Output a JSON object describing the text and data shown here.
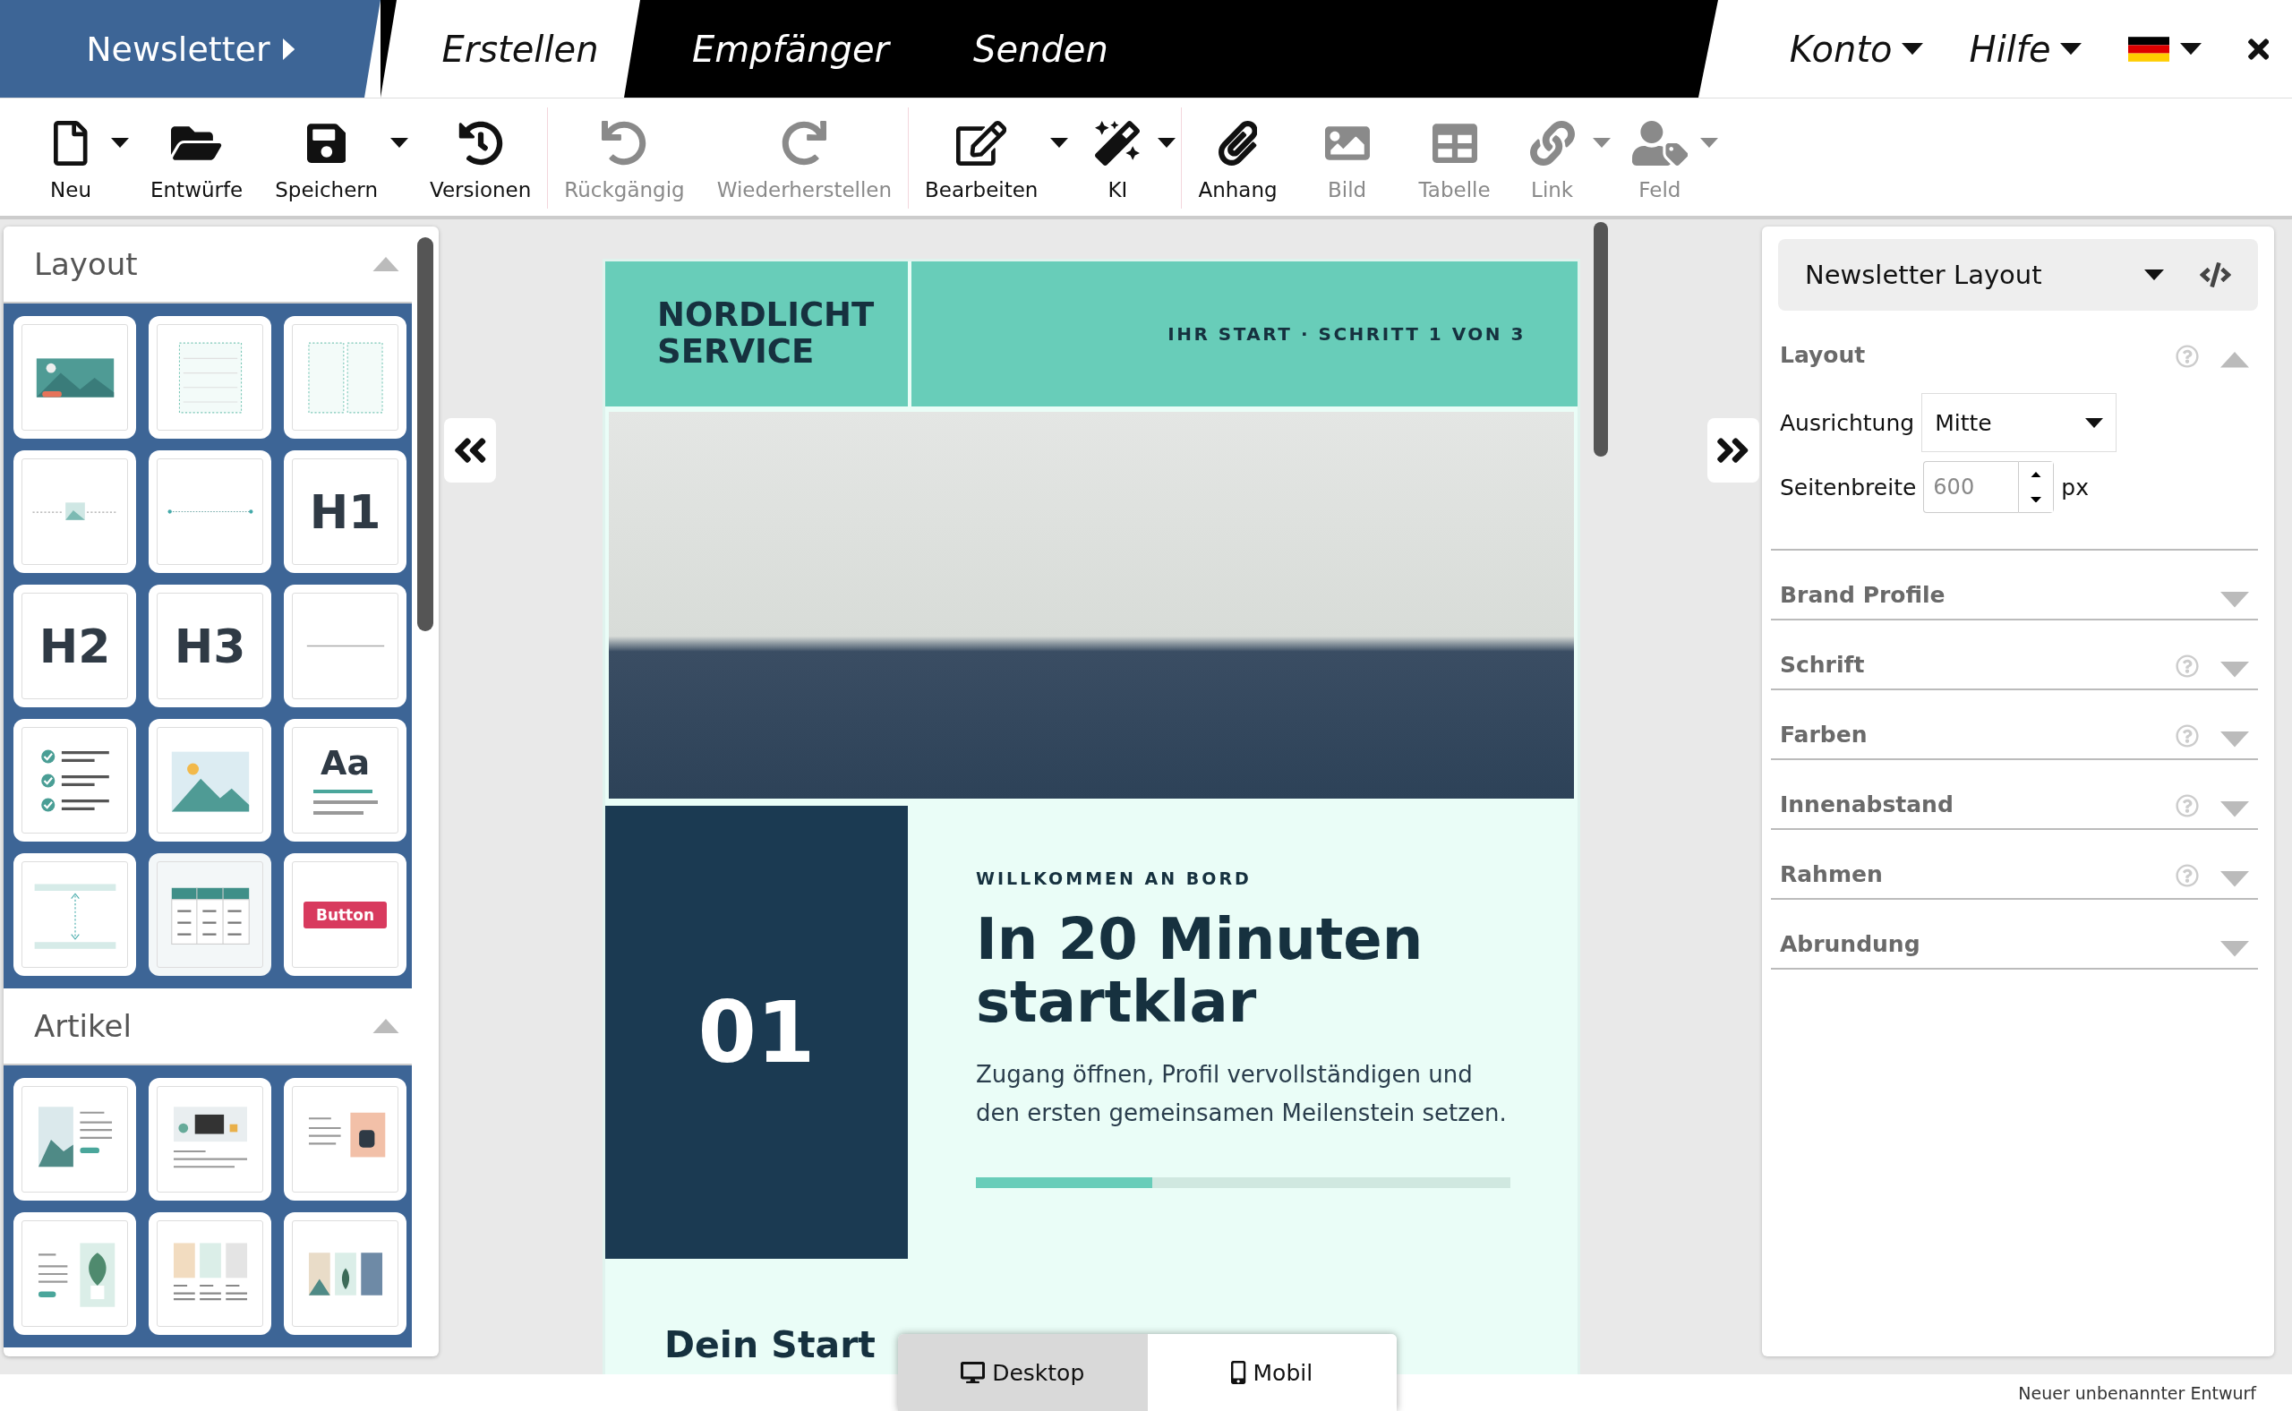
{
  "app_menu": {
    "label": "Newsletter"
  },
  "tabs": [
    {
      "label": "Erstellen",
      "selected": true
    },
    {
      "label": "Empfänger",
      "selected": false
    },
    {
      "label": "Senden",
      "selected": false
    }
  ],
  "menus": [
    {
      "label": "Konto"
    },
    {
      "label": "Hilfe"
    }
  ],
  "toolbar": [
    [
      {
        "label": "Neu",
        "disabled": false,
        "menu": true
      },
      {
        "label": "Entwürfe",
        "disabled": false,
        "menu": false
      },
      {
        "label": "Speichern",
        "disabled": false,
        "menu": true
      },
      {
        "label": "Versionen",
        "disabled": false,
        "menu": false
      }
    ],
    [
      {
        "label": "Rückgängig",
        "disabled": true,
        "menu": false
      },
      {
        "label": "Wiederherstellen",
        "disabled": true,
        "menu": false
      }
    ],
    [
      {
        "label": "Bearbeiten",
        "disabled": false,
        "menu": true
      },
      {
        "label": "KI",
        "disabled": false,
        "menu": true
      }
    ],
    [
      {
        "label": "Anhang",
        "disabled": false,
        "menu": false
      },
      {
        "label": "Bild",
        "disabled": true,
        "menu": false
      },
      {
        "label": "Tabelle",
        "disabled": true,
        "menu": false
      },
      {
        "label": "Link",
        "disabled": true,
        "menu": true
      },
      {
        "label": "Feld",
        "disabled": true,
        "menu": true
      }
    ]
  ],
  "left_panel": {
    "sections": [
      {
        "title": "Layout",
        "expanded": true,
        "tiles": [
          {
            "kind": "hero"
          },
          {
            "kind": "one-column"
          },
          {
            "kind": "two-column"
          },
          {
            "kind": "image-divider"
          },
          {
            "kind": "dot-divider"
          },
          {
            "kind": "heading",
            "label": "H1"
          },
          {
            "kind": "heading",
            "label": "H2"
          },
          {
            "kind": "heading",
            "label": "H3"
          },
          {
            "kind": "line"
          },
          {
            "kind": "checklist"
          },
          {
            "kind": "image"
          },
          {
            "kind": "text",
            "label": "Aa"
          },
          {
            "kind": "spacer"
          },
          {
            "kind": "table"
          },
          {
            "kind": "button",
            "label": "Button"
          }
        ]
      },
      {
        "title": "Artikel",
        "expanded": true,
        "tiles": [
          {
            "kind": "article-left"
          },
          {
            "kind": "article-top"
          },
          {
            "kind": "article-right"
          },
          {
            "kind": "article-plant"
          },
          {
            "kind": "three-columns"
          },
          {
            "kind": "three-images"
          }
        ]
      }
    ]
  },
  "email": {
    "brand": "NORDLICHT SERVICE",
    "step": "IHR START · SCHRITT 1 VON 3",
    "number": "01",
    "eyebrow": "WILLKOMMEN AN BORD",
    "heading": "In 20 Minuten startklar",
    "body": "Zugang öffnen, Profil vervollständigen und den ersten gemeinsamen Meilenstein setzen.",
    "progress": {
      "level": 0.33
    },
    "next_heading": "Dein Start"
  },
  "view_toggle": [
    {
      "label": "Desktop",
      "selected": true
    },
    {
      "label": "Mobil",
      "selected": false
    }
  ],
  "right_panel": {
    "preset": "Newsletter Layout",
    "sections": [
      {
        "title": "Layout",
        "help": true,
        "expanded": true,
        "fields": [
          {
            "kind": "select",
            "label": "Ausrichtung",
            "value": "Mitte"
          },
          {
            "kind": "number",
            "label": "Seitenbreite",
            "placeholder": "600",
            "unit": "px"
          }
        ]
      },
      {
        "title": "Brand Profile",
        "help": false,
        "expanded": false
      },
      {
        "title": "Schrift",
        "help": true,
        "expanded": false
      },
      {
        "title": "Farben",
        "help": true,
        "expanded": false
      },
      {
        "title": "Innenabstand",
        "help": true,
        "expanded": false
      },
      {
        "title": "Rahmen",
        "help": true,
        "expanded": false
      },
      {
        "title": "Abrundung",
        "help": false,
        "expanded": false
      }
    ]
  },
  "status_bar": {
    "text": "Neuer unbenannter Entwurf"
  }
}
